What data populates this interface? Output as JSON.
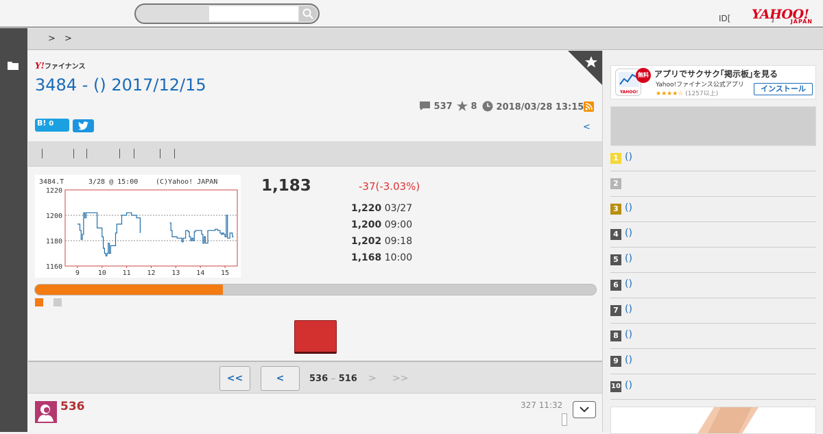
{
  "header": {
    "search": {
      "placeholder": "",
      "value": ""
    },
    "login_id": "ID[",
    "login_mark": "]",
    "logo": {
      "main": "YAHOO!",
      "sub": "JAPAN"
    }
  },
  "breadcrumb": {
    "sep1": ">",
    "sep2": ">"
  },
  "main": {
    "finance_logo": {
      "y": "Y!",
      "text": "ファイナンス"
    },
    "title": "3484 - () 2017/12/15",
    "meta": {
      "comments": "537",
      "favorites": "8",
      "datetime": "2018/03/28 13:15"
    },
    "hatena": {
      "label": "B!",
      "count": "0"
    },
    "prev_link": "<",
    "tab_separators": 7
  },
  "chart_data": {
    "type": "line",
    "title": "3484.T",
    "subtitle": "3/28 @ 15:00",
    "credit": "(C)Yahoo! JAPAN",
    "ylim": [
      1160,
      1220
    ],
    "yticks": [
      "1220",
      "1200",
      "1180",
      "1160"
    ],
    "xticks": [
      "9",
      "10",
      "11",
      "12",
      "13",
      "14",
      "15"
    ],
    "xlim": [
      8.5,
      15.5
    ],
    "series": [
      {
        "x": [
          9.0,
          9.1,
          9.15,
          9.2,
          9.25,
          9.3,
          9.35,
          9.4,
          9.5,
          9.6,
          9.7,
          9.8,
          9.9,
          10.0,
          10.05,
          10.1,
          10.15,
          10.2,
          10.25,
          10.3,
          10.35,
          10.45,
          10.55,
          10.6,
          10.7,
          10.8,
          10.9,
          11.0,
          11.1,
          11.2,
          11.3,
          11.4,
          11.5,
          11.55
        ],
        "y": [
          1193,
          1188,
          1181,
          1185,
          1202,
          1198,
          1202,
          1202,
          1202,
          1202,
          1202,
          1190,
          1190,
          1183,
          1174,
          1170,
          1168,
          1170,
          1178,
          1170,
          1176,
          1176,
          1186,
          1193,
          1193,
          1200,
          1200,
          1202,
          1202,
          1200,
          1200,
          1198,
          1198,
          1186
        ]
      },
      {
        "x": [
          12.75,
          12.8,
          12.85,
          12.9,
          13.0,
          13.05,
          13.1,
          13.2,
          13.25,
          13.3,
          13.4,
          13.5,
          13.55,
          13.6,
          13.65,
          13.7,
          13.75,
          13.8,
          13.9,
          14.0,
          14.05,
          14.1,
          14.15,
          14.2,
          14.25,
          14.3,
          14.4,
          14.5,
          14.6,
          14.7,
          14.8,
          14.85,
          14.9,
          14.95,
          15.0,
          15.05,
          15.1,
          15.2,
          15.3,
          15.35
        ],
        "y": [
          1194,
          1188,
          1183,
          1183,
          1183,
          1182,
          1182,
          1182,
          1179,
          1182,
          1188,
          1187,
          1183,
          1180,
          1182,
          1180,
          1187,
          1188,
          1188,
          1188,
          1185,
          1178,
          1183,
          1178,
          1178,
          1188,
          1188,
          1188,
          1189,
          1188,
          1186,
          1185,
          1186,
          1185,
          1183,
          1200,
          1182,
          1186,
          1183,
          1183
        ]
      }
    ]
  },
  "quote": {
    "price": "1,183",
    "change": "-37(-3.03%)",
    "rows": [
      {
        "value": "1,220",
        "label": "03/27"
      },
      {
        "value": "1,200",
        "label": "09:00"
      },
      {
        "value": "1,202",
        "label": "09:18"
      },
      {
        "value": "1,168",
        "label": "10:00"
      }
    ]
  },
  "progress": {
    "fraction": 0.335,
    "fill_color": "#f47a12",
    "rest_color": "#cccccc"
  },
  "pager": {
    "first": "<<",
    "prev": "<",
    "range_from": "536",
    "range_sep": "–",
    "range_to": "516",
    "next": ">",
    "last": ">>"
  },
  "comment": {
    "number": "536",
    "time": "327 11:32"
  },
  "sidebar": {
    "app_ad": {
      "badge": "無料",
      "title": "アプリでサクサク｢掲示板｣を見る",
      "subtitle": "Yahoo!ファイナンス公式アプリ",
      "stars": "★★★★☆",
      "count": "(1257以上)",
      "install": "インストール",
      "icon_label": "YAHOO!"
    },
    "ranking": [
      {
        "rank": "1",
        "text": "()",
        "color": "#f5d73a"
      },
      {
        "rank": "2",
        "text": "",
        "color": "#b5b5b5"
      },
      {
        "rank": "3",
        "text": "()",
        "color": "#b8900f"
      },
      {
        "rank": "4",
        "text": "()",
        "color": "#555555"
      },
      {
        "rank": "5",
        "text": "()",
        "color": "#555555"
      },
      {
        "rank": "6",
        "text": "()",
        "color": "#555555"
      },
      {
        "rank": "7",
        "text": "()",
        "color": "#555555"
      },
      {
        "rank": "8",
        "text": "()",
        "color": "#555555"
      },
      {
        "rank": "9",
        "text": "()",
        "color": "#555555"
      },
      {
        "rank": "10",
        "text": "()",
        "color": "#555555"
      }
    ]
  },
  "colors": {
    "accent_blue": "#1a6bb8",
    "down_red": "#dd3333",
    "brand_red": "#d7001b"
  },
  "icons": [
    "search-icon",
    "folder-icon",
    "star-icon",
    "comment-icon",
    "clock-icon",
    "rss-icon",
    "twitter-icon",
    "chevron-down-icon"
  ]
}
